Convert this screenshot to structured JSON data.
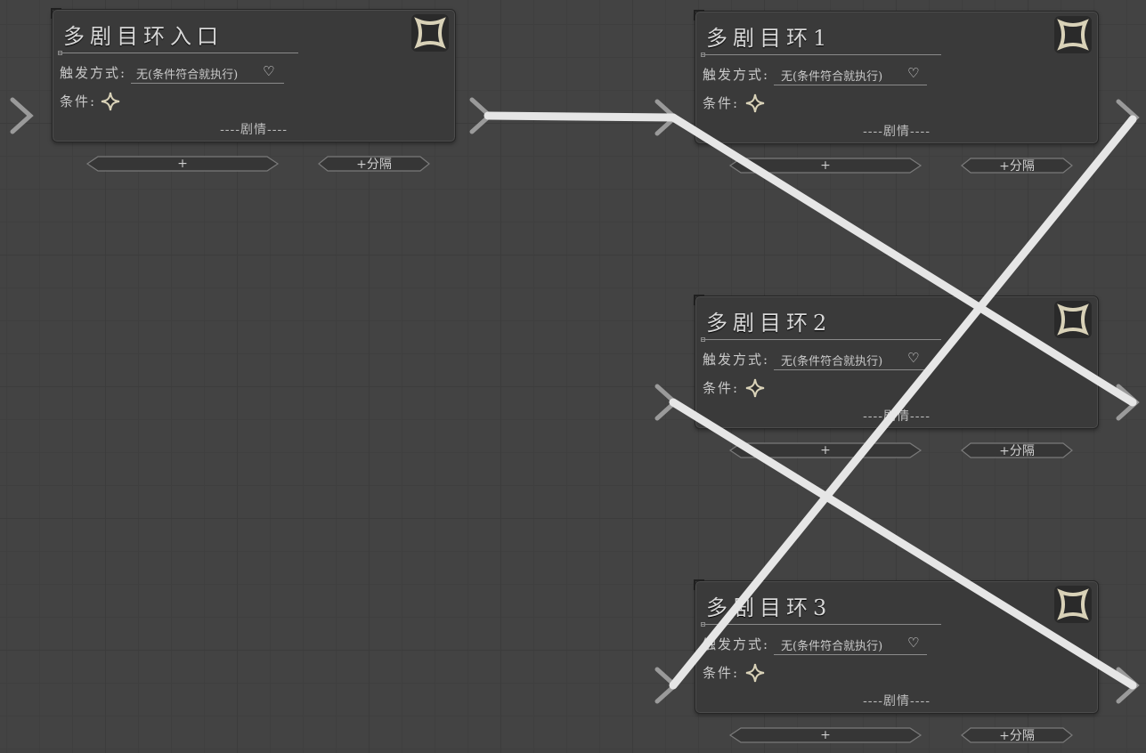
{
  "labels": {
    "trigger_label": "触发方式:",
    "trigger_value": "无(条件符合就执行)",
    "condition_label": "条件:",
    "plot": "----剧情----",
    "add_button": "+",
    "add_separator_button": "+分隔"
  },
  "nodes": [
    {
      "id": "entry",
      "title": "多剧目环入口"
    },
    {
      "id": "loop1",
      "title": "多剧目环1"
    },
    {
      "id": "loop2",
      "title": "多剧目环2"
    },
    {
      "id": "loop3",
      "title": "多剧目环3"
    }
  ],
  "connections": [
    {
      "from": "entry",
      "to": "loop1"
    },
    {
      "from": "loop1",
      "to": "loop3"
    },
    {
      "from": "loop2",
      "to": "loop1"
    },
    {
      "from": "loop3",
      "to": "loop2"
    }
  ],
  "colors": {
    "canvas": "#434343",
    "node_bg": "#3a3a3a",
    "wire": "#e6e6e6",
    "port": "#9a9a9a",
    "icon_fill": "#d9d2b8"
  }
}
